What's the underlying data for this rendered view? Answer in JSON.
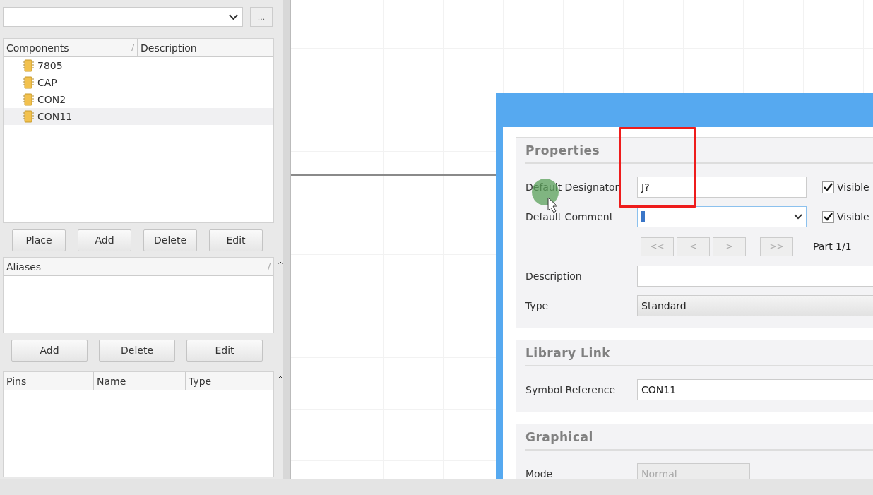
{
  "library_panel": {
    "browse_button": "...",
    "components": {
      "columns": [
        "Components",
        "Description"
      ],
      "sort_mark": "/",
      "items": [
        {
          "name": "7805",
          "selected": false
        },
        {
          "name": "CAP",
          "selected": false
        },
        {
          "name": "CON2",
          "selected": false
        },
        {
          "name": "CON11",
          "selected": true
        }
      ]
    },
    "component_buttons": [
      "Place",
      "Add",
      "Delete",
      "Edit"
    ],
    "aliases": {
      "columns": [
        "Aliases"
      ],
      "sort_mark": "/"
    },
    "alias_buttons": [
      "Add",
      "Delete",
      "Edit"
    ],
    "pins": {
      "columns": [
        "Pins",
        "Name",
        "Type"
      ]
    }
  },
  "dialog": {
    "groups": [
      {
        "title": "Properties",
        "rows": [
          {
            "kind": "text",
            "label": "Default Designator",
            "value": "J?",
            "visible_checkbox": {
              "label": "Visible",
              "checked": true
            }
          },
          {
            "kind": "combo",
            "label": "Default Comment",
            "value": "",
            "focused": true,
            "visible_checkbox": {
              "label": "Visible",
              "checked": true
            }
          },
          {
            "kind": "nav",
            "buttons": [
              {
                "label": "<<",
                "disabled": true
              },
              {
                "label": "<",
                "disabled": true
              },
              {
                "label": ">",
                "disabled": true
              },
              {
                "label": ">>",
                "disabled": true
              }
            ],
            "part": "Part 1/1"
          },
          {
            "kind": "text",
            "label": "Description",
            "value": ""
          },
          {
            "kind": "select",
            "label": "Type",
            "value": "Standard"
          }
        ]
      },
      {
        "title": "Library Link",
        "rows": [
          {
            "kind": "text",
            "label": "Symbol Reference",
            "value": "CON11"
          }
        ]
      },
      {
        "title": "Graphical",
        "rows": [
          {
            "kind": "select",
            "label": "Mode",
            "value": "Normal",
            "disabled": true
          }
        ]
      }
    ]
  },
  "annotation": {
    "kind": "highlight"
  }
}
